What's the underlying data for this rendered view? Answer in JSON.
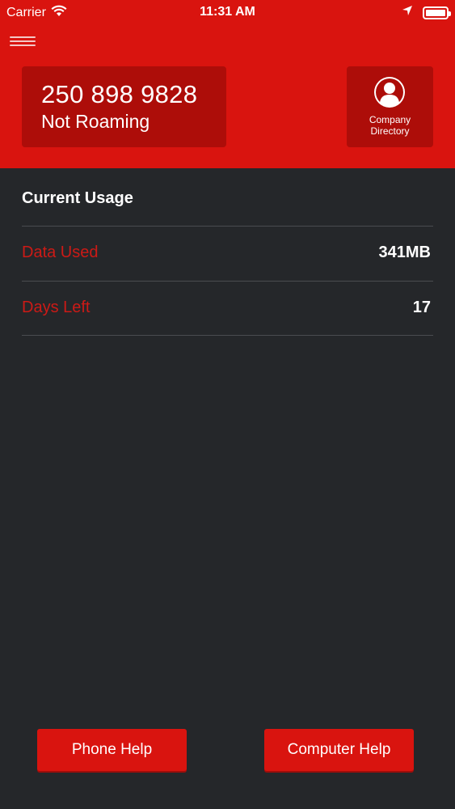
{
  "status_bar": {
    "carrier": "Carrier",
    "time": "11:31 AM"
  },
  "header": {
    "phone_number": "250 898 9828",
    "roaming_status": "Not Roaming",
    "directory_label": "Company Directory"
  },
  "usage": {
    "title": "Current Usage",
    "rows": [
      {
        "label": "Data Used",
        "value": "341MB"
      },
      {
        "label": "Days Left",
        "value": "17"
      }
    ]
  },
  "footer": {
    "phone_help": "Phone Help",
    "computer_help": "Computer Help"
  },
  "colors": {
    "header_red": "#d9140f",
    "card_red": "#ad0d09",
    "background": "#25272a",
    "label_red": "#cc1a16"
  }
}
